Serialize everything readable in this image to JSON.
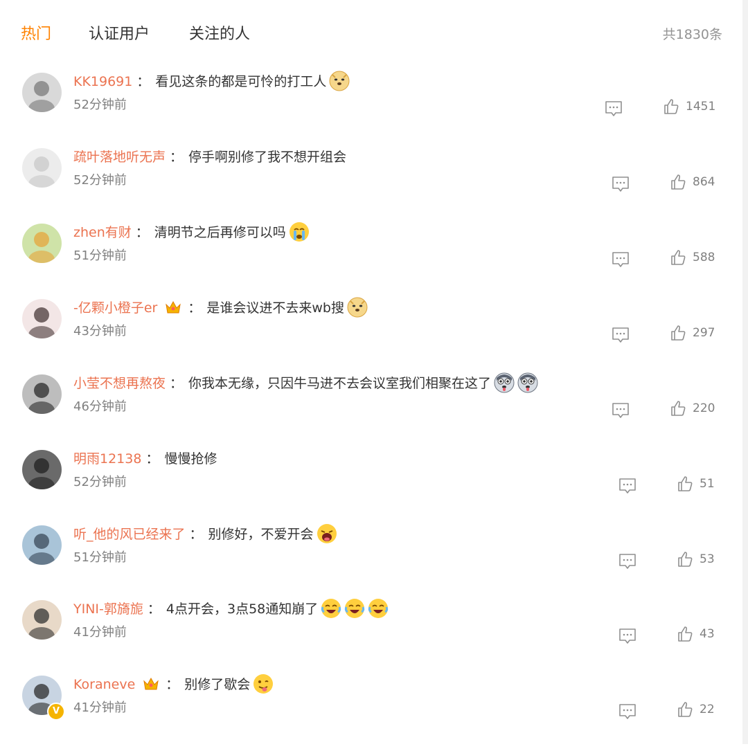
{
  "tabs": [
    {
      "label": "热门",
      "active": true
    },
    {
      "label": "认证用户",
      "active": false
    },
    {
      "label": "关注的人",
      "active": false
    }
  ],
  "total_count": "共1830条",
  "colors": {
    "accent": "#ff8200",
    "username": "#eb7350",
    "meta": "#808080"
  },
  "comments": [
    {
      "user": "KK19691",
      "text": "看见这条的都是可怜的打工人",
      "emojis": [
        "doge"
      ],
      "time": "52分钟前",
      "likes": "1451",
      "badge": null
    },
    {
      "user": "疏叶落地听无声",
      "text": "停手啊别修了我不想开组会",
      "emojis": [],
      "time": "52分钟前",
      "likes": "864",
      "badge": null
    },
    {
      "user": "zhen有财",
      "text": "清明节之后再修可以吗",
      "emojis": [
        "crying-face"
      ],
      "time": "51分钟前",
      "likes": "588",
      "badge": null
    },
    {
      "user": "-亿颗小橙子er",
      "text": "是谁会议进不去来wb搜",
      "emojis": [
        "doge"
      ],
      "time": "43分钟前",
      "likes": "297",
      "badge": "crown"
    },
    {
      "user": "小莹不想再熬夜",
      "text": "你我本无缘，只因牛马进不去会议室我们相聚在这了",
      "emojis": [
        "husky",
        "husky"
      ],
      "time": "46分钟前",
      "likes": "220",
      "badge": null
    },
    {
      "user": "明雨12138",
      "text": "慢慢抢修",
      "emojis": [],
      "time": "52分钟前",
      "likes": "51",
      "badge": null
    },
    {
      "user": "听_他的风已经来了",
      "text": "别修好，不爱开会",
      "emojis": [
        "yawn"
      ],
      "time": "51分钟前",
      "likes": "53",
      "badge": null
    },
    {
      "user": "YINI-郭旖旎",
      "text": "4点开会，3点58通知崩了",
      "emojis": [
        "laugh-cry",
        "laugh-cry",
        "laugh-cry"
      ],
      "time": "41分钟前",
      "likes": "43",
      "badge": null
    },
    {
      "user": "Koraneve",
      "text": "别修了歇会",
      "emojis": [
        "tongue-face"
      ],
      "time": "41分钟前",
      "likes": "22",
      "badge": "crown-v"
    }
  ]
}
